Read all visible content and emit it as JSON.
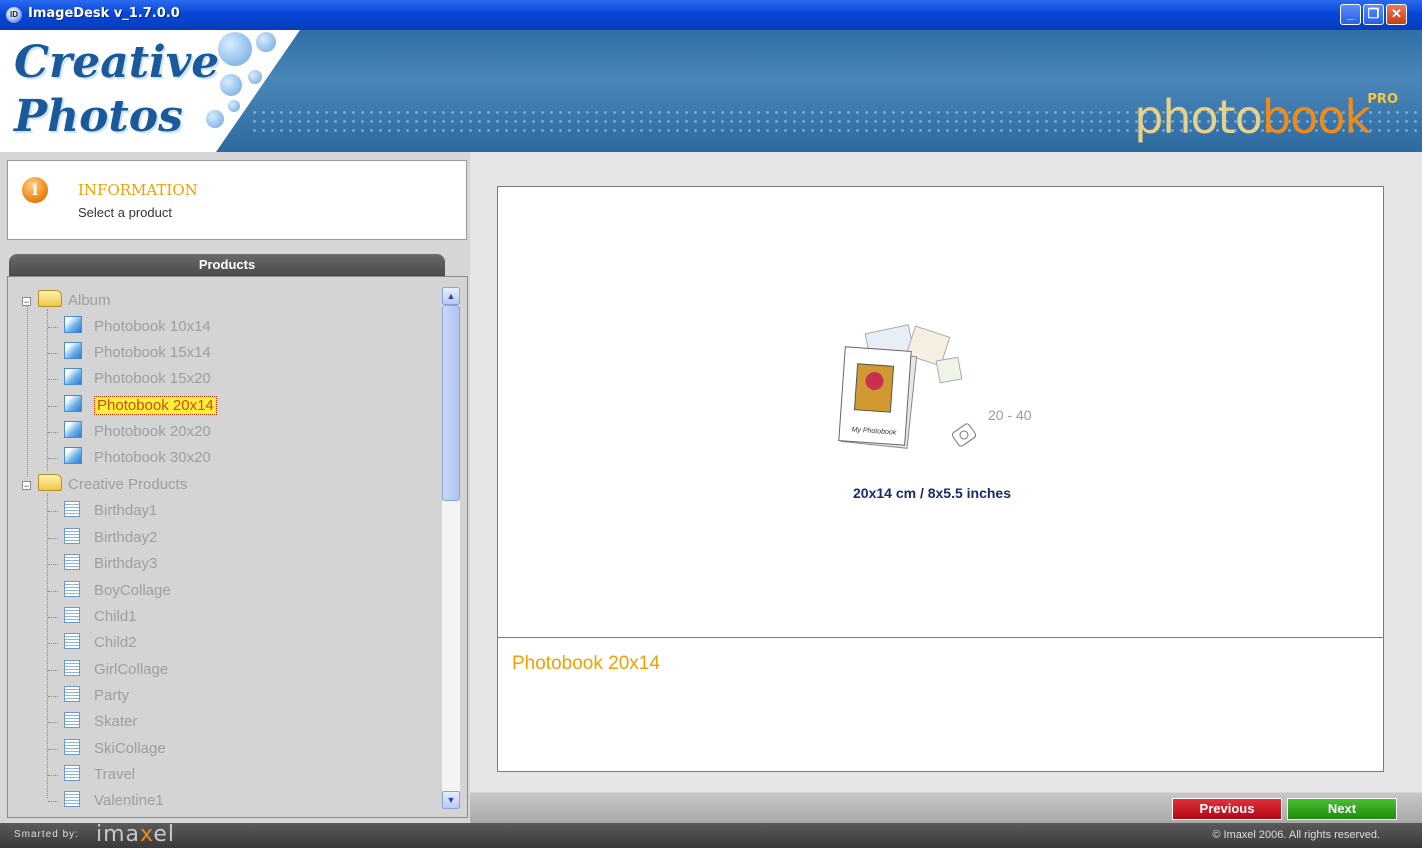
{
  "window": {
    "title": "ImageDesk v_1.7.0.0",
    "icon": "app-icon"
  },
  "banner": {
    "logo_line1": "Creative",
    "logo_line2": "Photos",
    "brand_part1": "photo",
    "brand_part2": "book",
    "brand_pro": "PRO"
  },
  "info": {
    "title": "INFORMATION",
    "subtitle": "Select a product"
  },
  "products": {
    "header": "Products",
    "groups": [
      {
        "label": "Album",
        "items": [
          "Photobook 10x14",
          "Photobook 15x14",
          "Photobook 15x20",
          "Photobook 20x14",
          "Photobook 20x20",
          "Photobook 30x20"
        ]
      },
      {
        "label": "Creative Products",
        "items": [
          "Birthday1",
          "Birthday2",
          "Birthday3",
          "BoyCollage",
          "Child1",
          "Child2",
          "GirlCollage",
          "Party",
          "Skater",
          "SkiCollage",
          "Travel",
          "Valentine1"
        ]
      }
    ],
    "selected": "Photobook 20x14"
  },
  "preview": {
    "range": "20 - 40",
    "book_label": "My Photobook",
    "size_caption": "20x14 cm / 8x5.5 inches",
    "product_name": "Photobook 20x14"
  },
  "nav": {
    "previous": "Previous",
    "next": "Next"
  },
  "footer": {
    "smarted_by": "Smarted by:",
    "brand_a": "ima",
    "brand_b": "x",
    "brand_c": "el",
    "copyright": "© Imaxel 2006. All rights reserved."
  },
  "colors": {
    "accent_orange": "#f0a000",
    "previous_red": "#c8101c",
    "next_green": "#2a9a1a",
    "title_blue": "#0a46d6"
  }
}
